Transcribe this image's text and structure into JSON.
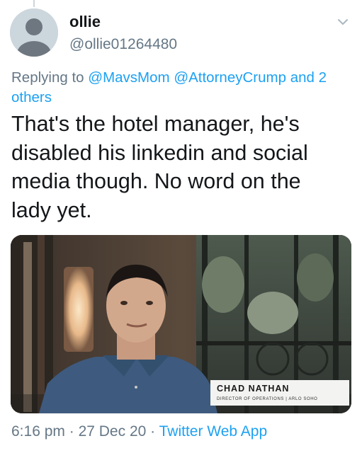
{
  "author": {
    "display_name": "ollie",
    "handle": "@ollie01264480"
  },
  "replying": {
    "prefix": "Replying to",
    "mention_1": "@MavsMom",
    "mention_2": "@AttorneyCrump",
    "and_others": "and 2 others"
  },
  "tweet": {
    "text": "That's the hotel manager, he's disabled his linkedin and social media though. No word on the lady yet."
  },
  "media": {
    "lower_third_name": "CHAD NATHAN",
    "lower_third_title": "DIRECTOR OF OPERATIONS | ARLO SOHO"
  },
  "meta": {
    "time": "6:16 pm",
    "separator": "·",
    "date": "27 Dec 20",
    "source": "Twitter Web App"
  },
  "icons": {
    "avatar": "default-profile-avatar",
    "caret": "chevron-down-icon"
  },
  "colors": {
    "link": "#1da1f2",
    "secondary_text": "#657786",
    "primary_text": "#14171a"
  }
}
